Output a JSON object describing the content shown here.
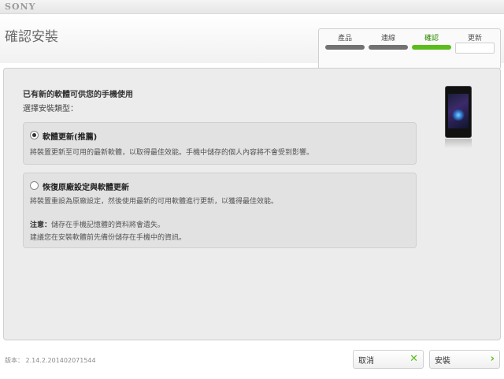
{
  "brand": "SONY",
  "page_title": "確認安裝",
  "steps": [
    {
      "label": "產品",
      "state": "done"
    },
    {
      "label": "連線",
      "state": "done"
    },
    {
      "label": "確認",
      "state": "active"
    },
    {
      "label": "更新",
      "state": "pending"
    }
  ],
  "main": {
    "heading": "已有新的軟體可供您的手機使用",
    "subheading": "選擇安裝類型：",
    "options": [
      {
        "title": "軟體更新(推薦)",
        "selected": true,
        "desc": "將裝置更新至可用的最新軟體，以取得最佳效能。手機中儲存的個人內容將不會受到影響。"
      },
      {
        "title": "恢復原廠設定與軟體更新",
        "selected": false,
        "desc": "將裝置重設為原廠設定，然後使用最新的可用軟體進行更新，以獲得最佳效能。",
        "note_label": "注意：",
        "note_text": "儲存在手機記憶體的資料將會遺失。",
        "note_line2": "建議您在安裝軟體前先備份儲存在手機中的資訊。"
      }
    ]
  },
  "footer": {
    "version": "版本： 2.14.2.201402071544",
    "cancel_label": "取消",
    "install_label": "安裝"
  },
  "colors": {
    "accent": "#5bbd1c",
    "panel": "#ececec"
  },
  "icons": {
    "cancel": "close-icon",
    "install": "chevron-right-icon"
  }
}
